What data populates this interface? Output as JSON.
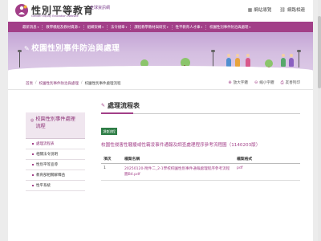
{
  "header": {
    "site_title": "性別平等教育",
    "badge": "全球資訊網",
    "subtitle": "Gender Equity Education Website",
    "links": [
      {
        "label": "網站導覽",
        "icon": "sitemap-icon"
      },
      {
        "label": "網路相連",
        "icon": "link-icon"
      }
    ]
  },
  "nav": {
    "items": [
      "最新消息",
      "教學模組及教材資源",
      "組織架構",
      "法令規章",
      "課程教學教材與研究",
      "性平教育人才庫",
      "校園性別事件防治與處理"
    ]
  },
  "banner": {
    "title": "校園性別事件防治與處理"
  },
  "breadcrumb": {
    "items": [
      "首頁",
      "校園性別事件防治與處理",
      "校園性別事件處理流程"
    ]
  },
  "tools": [
    {
      "label": "放大字體",
      "icon": "plus-icon"
    },
    {
      "label": "縮小字體",
      "icon": "minus-icon"
    },
    {
      "label": "友善列印",
      "icon": "print-icon"
    }
  ],
  "sidebar": {
    "heading": "校園性別事件處理流程",
    "items": [
      "處理流程表",
      "相關法令說明",
      "性別平等宣導",
      "教育部相關解釋函",
      "性平系統"
    ]
  },
  "main": {
    "title": "處理流程表",
    "tag": "調查流程",
    "doc_title": "校園性侵害性騷擾或性霸凌事件通報及調查處理程序參考流程圖（1140203版）",
    "table": {
      "headers": [
        "項次",
        "檔案名稱",
        "檔案格式"
      ],
      "rows": [
        {
          "index": "1",
          "name": "20250120-附件二_2-1學校校園性別事件通報處理程序參考流程圖B4.pdf",
          "format": "pdf"
        }
      ]
    }
  },
  "colors": {
    "accent": "#a23f88",
    "tag": "#2e7d46"
  }
}
